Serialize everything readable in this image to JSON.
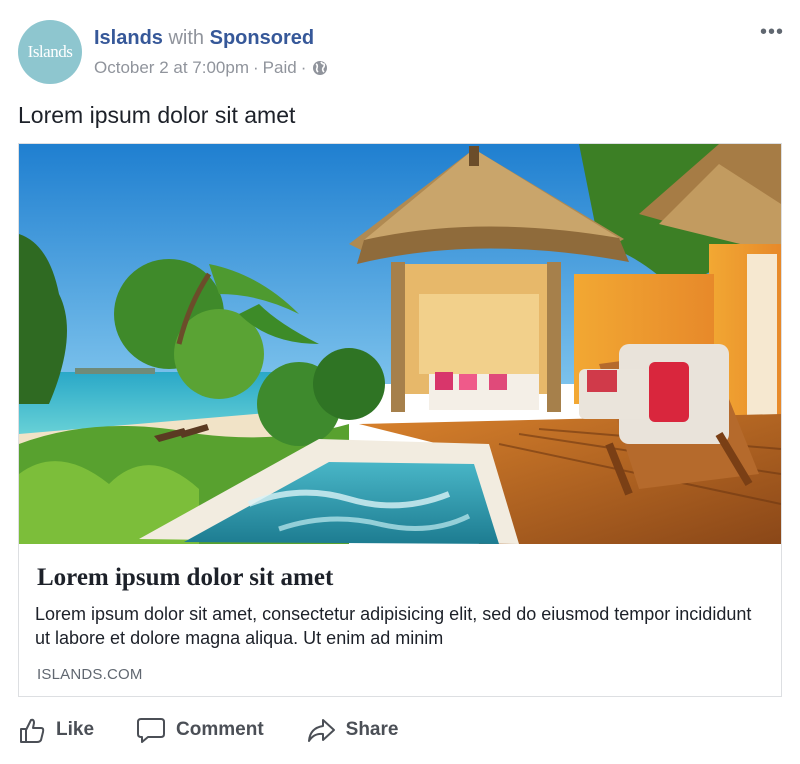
{
  "header": {
    "avatar_text": "Islands",
    "page_name": "Islands",
    "with_word": "with",
    "sponsor": "Sponsored",
    "date": "October 2 at 7:00pm",
    "separator": "·",
    "paid": "Paid",
    "more": "•••",
    "icons": {
      "privacy": "globe-icon",
      "more": "more-options-icon"
    }
  },
  "post": {
    "text": "Lorem ipsum dolor sit amet"
  },
  "card": {
    "image": "resort-bungalow-pool-photo",
    "title": "Lorem ipsum dolor sit amet",
    "description": "Lorem ipsum dolor sit amet, consectetur adipisicing elit, sed do eiusmod tempor incididunt ut labore et dolore magna aliqua. Ut enim ad minim",
    "domain": "ISLANDS.COM"
  },
  "actions": [
    {
      "label": "Like",
      "icon": "thumbs-up-icon"
    },
    {
      "label": "Comment",
      "icon": "comment-icon"
    },
    {
      "label": "Share",
      "icon": "share-icon"
    }
  ],
  "colors": {
    "link": "#365899",
    "meta": "#90949c",
    "text": "#1d2129",
    "action": "#4b4f56",
    "avatar": "#8ec6cf"
  }
}
